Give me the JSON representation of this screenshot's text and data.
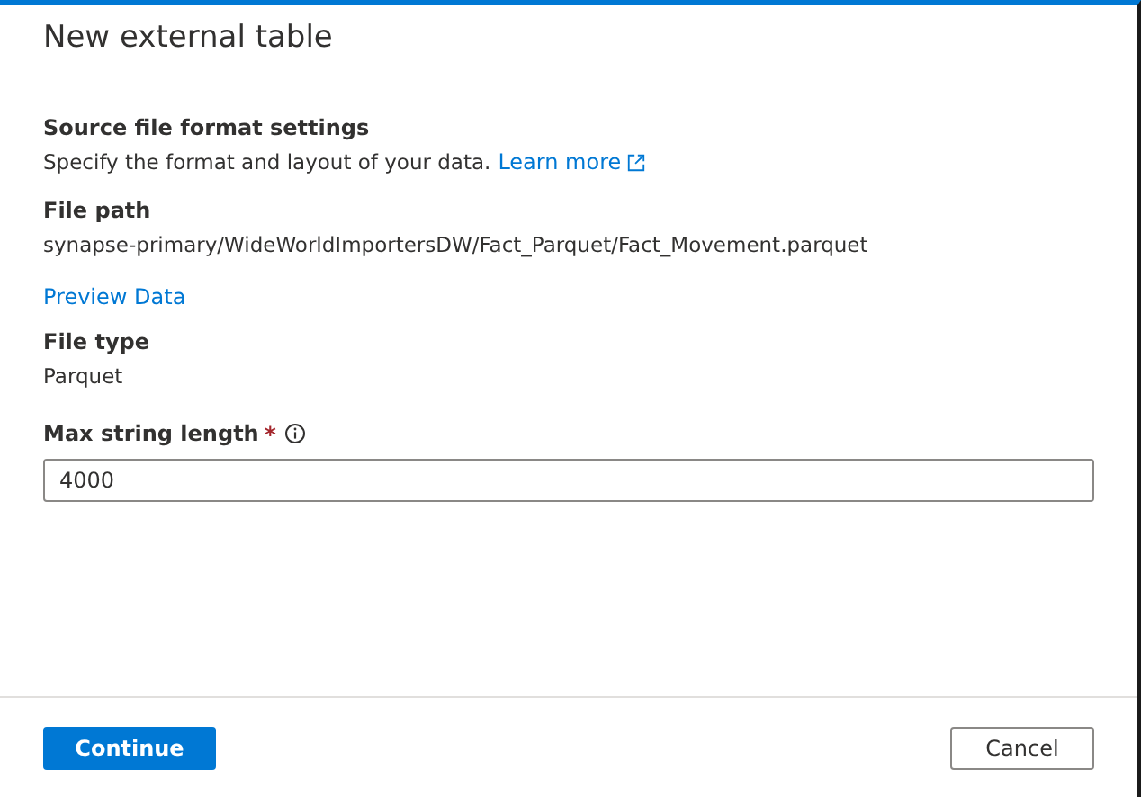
{
  "title": "New external table",
  "section": {
    "heading": "Source file format settings",
    "description": "Specify the format and layout of your data.",
    "link": "Learn more"
  },
  "fields": [
    {
      "kind": "readonly",
      "label": "File path",
      "value": "synapse-primary/WideWorldImportersDW/Fact_Parquet/Fact_Movement.parquet"
    },
    {
      "kind": "link",
      "label": "Preview Data"
    },
    {
      "kind": "readonly",
      "label": "File type",
      "value": "Parquet"
    },
    {
      "kind": "input",
      "label": "Max string length",
      "required_mark": "*",
      "info": true,
      "value": "4000"
    }
  ],
  "buttons": [
    {
      "label": "Continue",
      "kind": "primary"
    },
    {
      "label": "Cancel",
      "kind": "secondary"
    }
  ]
}
